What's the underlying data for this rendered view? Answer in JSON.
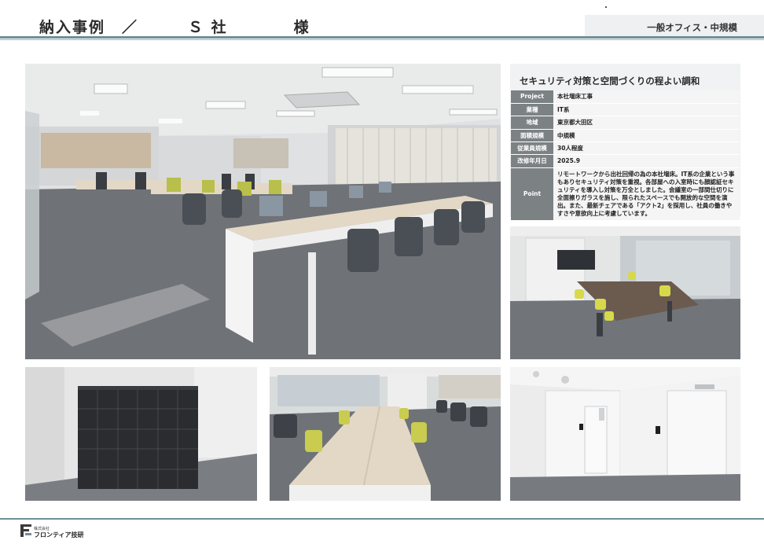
{
  "header": {
    "title": "納入事例　／　　　Ｓ 社　　　　様",
    "category": "一般オフィス・中規模"
  },
  "info": {
    "heading": "セキュリティ対策と空間づくりの程よい調和",
    "rows": [
      {
        "label": "Project",
        "value": "本社増床工事"
      },
      {
        "label": "業種",
        "value": "IT系"
      },
      {
        "label": "地域",
        "value": "東京都大田区"
      },
      {
        "label": "面積規模",
        "value": "中規模"
      },
      {
        "label": "従業員規模",
        "value": "30人程度"
      },
      {
        "label": "改修年月日",
        "value": "2025.9"
      }
    ],
    "point": {
      "label": "Point",
      "value": "リモートワークから出社回帰の為の本社増床。IT系の企業という事もありセキュリティ対策を重視。各部屋への入室時にも顔認証セキュリティを導入し対策を万全としました。会議室の一部間仕切りに全面擦りガラスを施し、限られたスペースでも開放的な空間を演出。また、最新チェアである「アクト2」を採用し、社員の働きやすさや意欲向上に考慮しています。"
    }
  },
  "footer": {
    "company_prefix": "株式会社",
    "company_name": "フロンティア技研"
  },
  "colors": {
    "rule": "#6f8f98",
    "label_bg": "#7c8184",
    "panel_bg": "#f1f2f3",
    "carpet": "#6f7276",
    "desk_top": "#e3d8c6",
    "chair_accent": "#b8bf4a",
    "meeting_table": "#6b5a4e"
  }
}
